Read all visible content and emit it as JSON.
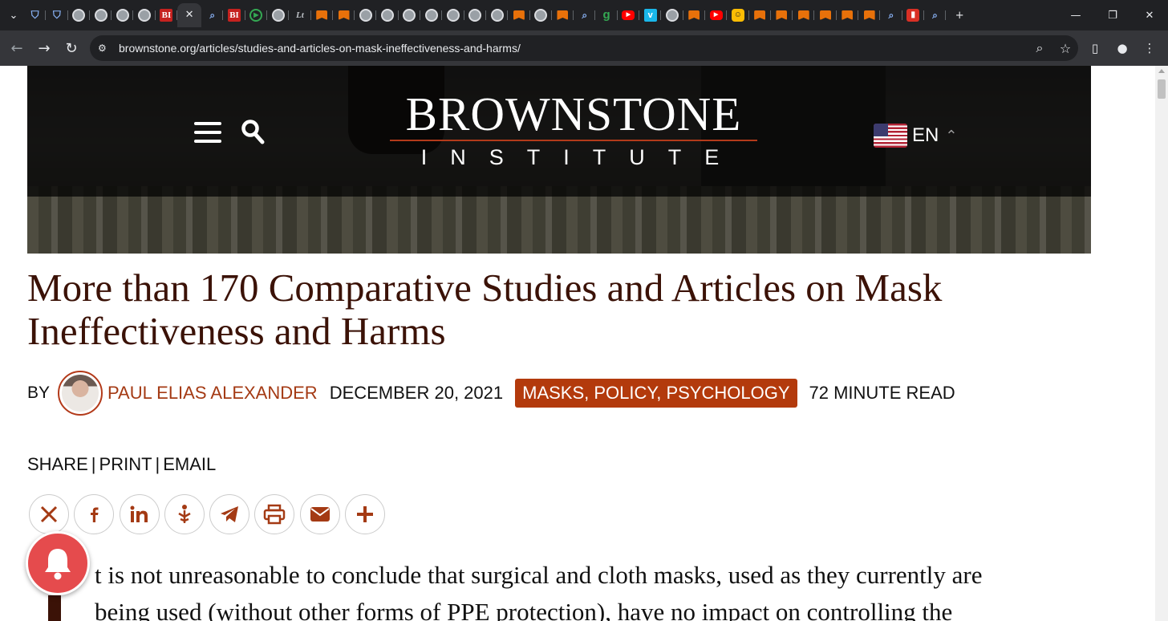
{
  "browser": {
    "tab_count_label": "",
    "tabs": [
      {
        "icon": "shield-icon",
        "active": false
      },
      {
        "icon": "shield-icon",
        "active": false
      },
      {
        "icon": "globe-icon",
        "active": false
      },
      {
        "icon": "globe-icon",
        "active": false
      },
      {
        "icon": "globe-icon",
        "active": false
      },
      {
        "icon": "globe-icon",
        "active": false
      },
      {
        "icon": "bi-icon",
        "active": false
      },
      {
        "icon": "close-icon",
        "active": true
      },
      {
        "icon": "search-icon",
        "active": false
      },
      {
        "icon": "bi-icon",
        "active": false
      },
      {
        "icon": "play-icon",
        "active": false
      },
      {
        "icon": "globe-icon",
        "active": false
      },
      {
        "icon": "italic-icon",
        "active": false
      },
      {
        "icon": "bookmark-icon",
        "active": false
      },
      {
        "icon": "bookmark-icon",
        "active": false
      },
      {
        "icon": "globe-icon",
        "active": false
      },
      {
        "icon": "globe-icon",
        "active": false
      },
      {
        "icon": "globe-icon",
        "active": false
      },
      {
        "icon": "globe-icon",
        "active": false
      },
      {
        "icon": "globe-icon",
        "active": false
      },
      {
        "icon": "globe-icon",
        "active": false
      },
      {
        "icon": "globe-icon",
        "active": false
      },
      {
        "icon": "bookmark-icon",
        "active": false
      },
      {
        "icon": "globe-icon",
        "active": false
      },
      {
        "icon": "bookmark-icon",
        "active": false
      },
      {
        "icon": "search-icon",
        "active": false
      },
      {
        "icon": "g-icon",
        "active": false
      },
      {
        "icon": "youtube-icon",
        "active": false
      },
      {
        "icon": "vimeo-icon",
        "active": false
      },
      {
        "icon": "globe-icon",
        "active": false
      },
      {
        "icon": "bookmark-icon",
        "active": false
      },
      {
        "icon": "youtube-icon",
        "active": false
      },
      {
        "icon": "chat-icon",
        "active": false
      },
      {
        "icon": "bookmark-icon",
        "active": false
      },
      {
        "icon": "bookmark-icon",
        "active": false
      },
      {
        "icon": "bookmark-icon",
        "active": false
      },
      {
        "icon": "bookmark-icon",
        "active": false
      },
      {
        "icon": "bookmark-icon",
        "active": false
      },
      {
        "icon": "bookmark-icon",
        "active": false
      },
      {
        "icon": "search-icon",
        "active": false
      },
      {
        "icon": "mic-icon",
        "active": false
      },
      {
        "icon": "search-icon",
        "active": false
      }
    ],
    "url": "brownstone.org/articles/studies-and-articles-on-mask-ineffectiveness-and-harms/",
    "icon_glyphs": {
      "close": "✕",
      "new_tab": "+",
      "minimize": "—",
      "restore": "❐",
      "win_close": "✕",
      "back": "←",
      "forward": "→",
      "reload": "↻",
      "zoom": "⌕",
      "star": "☆",
      "sidepanel": "▯",
      "profile": "●",
      "kebab": "⋮",
      "tab_search": "⌄",
      "tune": "⚙"
    }
  },
  "site": {
    "logo_main": "BROWNSTONE",
    "logo_sub": "INSTITUTE",
    "language": "EN",
    "accent_color": "#b33a0c"
  },
  "article": {
    "title": "More than 170 Comparative Studies and Articles on Mask Ineffectiveness and Harms",
    "by": "BY",
    "author": "PAUL ELIAS ALEXANDER",
    "date": "DECEMBER 20, 2021",
    "tags": "MASKS, POLICY, PSYCHOLOGY",
    "read_time": "72 MINUTE READ",
    "share": "SHARE",
    "print": "PRINT",
    "email": "EMAIL",
    "share_buttons": [
      "x-icon",
      "facebook-icon",
      "linkedin-icon",
      "getpocket-icon",
      "telegram-icon",
      "print-icon",
      "email-icon",
      "plus-icon"
    ],
    "body_first_line": "t is not unreasonable to conclude that surgical and cloth masks, used as they currently are",
    "body_second_line": "being used (without other forms of PPE protection), have no impact on controlling the"
  }
}
